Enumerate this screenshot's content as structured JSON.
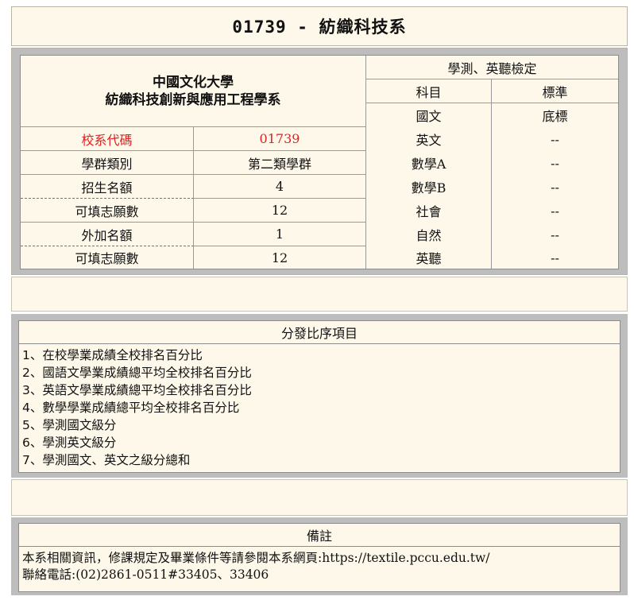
{
  "header": {
    "title": "01739 - 紡織科技系"
  },
  "school": {
    "university": "中國文化大學",
    "department": "紡織科技創新與應用工程學系"
  },
  "info_rows": [
    {
      "label": "校系代碼",
      "value": "01739"
    },
    {
      "label": "學群類別",
      "value": "第二類學群"
    },
    {
      "label": "招生名額",
      "value": "4"
    },
    {
      "label": "可填志願數",
      "value": "12"
    },
    {
      "label": "外加名額",
      "value": "1"
    },
    {
      "label": "可填志願數",
      "value": "12"
    }
  ],
  "exam": {
    "title": "學測、英聽檢定",
    "col_subject": "科目",
    "col_standard": "標準",
    "rows": [
      {
        "subject": "國文",
        "standard": "底標"
      },
      {
        "subject": "英文",
        "standard": "--"
      },
      {
        "subject": "數學A",
        "standard": "--"
      },
      {
        "subject": "數學B",
        "standard": "--"
      },
      {
        "subject": "社會",
        "standard": "--"
      },
      {
        "subject": "自然",
        "standard": "--"
      },
      {
        "subject": "英聽",
        "standard": "--"
      }
    ]
  },
  "ranking": {
    "title": "分發比序項目",
    "items": [
      "1、在校學業成績全校排名百分比",
      "2、國語文學業成績總平均全校排名百分比",
      "3、英語文學業成績總平均全校排名百分比",
      "4、數學學業成績總平均全校排名百分比",
      "5、學測國文級分",
      "6、學測英文級分",
      "7、學測國文、英文之級分總和"
    ]
  },
  "remarks": {
    "title": "備註",
    "lines": [
      "本系相關資訊，修課規定及畢業條件等請參閱本系網頁:https://textile.pccu.edu.tw/",
      "聯絡電話:(02)2861-0511#33405、33406"
    ]
  }
}
